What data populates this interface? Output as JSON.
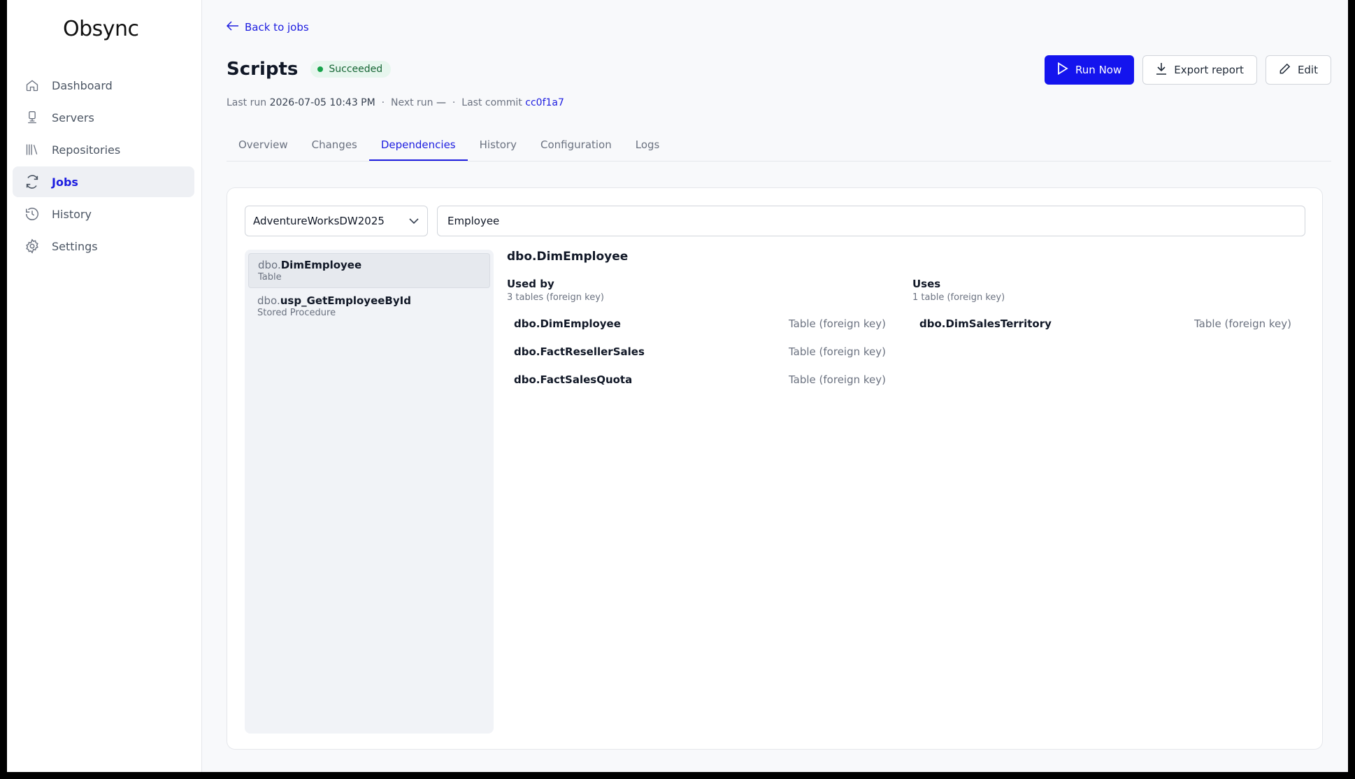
{
  "app": {
    "name": "Obsync"
  },
  "sidebar": {
    "items": [
      {
        "label": "Dashboard",
        "icon": "home-icon",
        "active": false
      },
      {
        "label": "Servers",
        "icon": "server-icon",
        "active": false
      },
      {
        "label": "Repositories",
        "icon": "library-icon",
        "active": false
      },
      {
        "label": "Jobs",
        "icon": "refresh-icon",
        "active": true
      },
      {
        "label": "History",
        "icon": "history-icon",
        "active": false
      },
      {
        "label": "Settings",
        "icon": "gear-icon",
        "active": false
      }
    ]
  },
  "header": {
    "back_label": "Back to jobs",
    "title": "Scripts",
    "status": "Succeeded",
    "status_color": "#16a34a",
    "meta": {
      "last_run_label": "Last run",
      "last_run_value": "2026-07-05 10:43 PM",
      "next_run_label": "Next run",
      "next_run_value": "—",
      "last_commit_label": "Last commit",
      "last_commit_value": "cc0f1a7",
      "separator": "·"
    },
    "actions": {
      "run_label": "Run Now",
      "export_label": "Export report",
      "edit_label": "Edit"
    }
  },
  "tabs": [
    {
      "label": "Overview",
      "active": false
    },
    {
      "label": "Changes",
      "active": false
    },
    {
      "label": "Dependencies",
      "active": true
    },
    {
      "label": "History",
      "active": false
    },
    {
      "label": "Configuration",
      "active": false
    },
    {
      "label": "Logs",
      "active": false
    }
  ],
  "dependencies": {
    "database": "AdventureWorksDW2025",
    "search_value": "Employee",
    "objects": [
      {
        "schema": "dbo.",
        "name": "DimEmployee",
        "type": "Table",
        "selected": true
      },
      {
        "schema": "dbo.",
        "name": "usp_GetEmployeeById",
        "type": "Stored Procedure",
        "selected": false
      }
    ],
    "detail": {
      "title": "dbo.DimEmployee",
      "used_by": {
        "heading": "Used by",
        "summary": "3 tables (foreign key)",
        "rows": [
          {
            "name": "dbo.DimEmployee",
            "type": "Table (foreign key)"
          },
          {
            "name": "dbo.FactResellerSales",
            "type": "Table (foreign key)"
          },
          {
            "name": "dbo.FactSalesQuota",
            "type": "Table (foreign key)"
          }
        ]
      },
      "uses": {
        "heading": "Uses",
        "summary": "1 table (foreign key)",
        "rows": [
          {
            "name": "dbo.DimSalesTerritory",
            "type": "Table (foreign key)"
          }
        ]
      }
    }
  },
  "colors": {
    "accent": "#1d1de0",
    "primary_button": "#1414ee"
  }
}
